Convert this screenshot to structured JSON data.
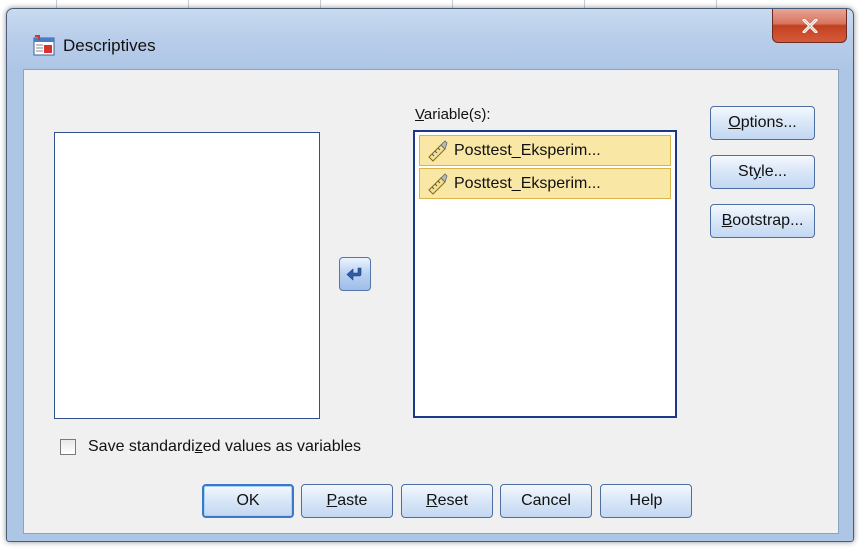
{
  "window": {
    "title": "Descriptives"
  },
  "variables_label": "Variable(s):",
  "variables_label_mnemonic": "V",
  "variables_label_rest": "ariable(s):",
  "selected_variables": [
    {
      "name": "Posttest_Eksperim...",
      "icon": "scale-ruler-icon"
    },
    {
      "name": "Posttest_Eksperim...",
      "icon": "scale-ruler-icon"
    }
  ],
  "side_buttons": {
    "options": {
      "pre": "",
      "mnemonic": "O",
      "post": "ptions..."
    },
    "style": {
      "pre": "St",
      "mnemonic": "y",
      "post": "le..."
    },
    "bootstrap": {
      "pre": "",
      "mnemonic": "B",
      "post": "ootstrap..."
    }
  },
  "checkbox": {
    "label_pre": "Save standardi",
    "label_mnemonic": "z",
    "label_post": "ed values as variables",
    "checked": false
  },
  "bottom_buttons": {
    "ok": {
      "pre": "OK",
      "mnemonic": "",
      "post": ""
    },
    "paste": {
      "pre": "",
      "mnemonic": "P",
      "post": "aste"
    },
    "reset": {
      "pre": "",
      "mnemonic": "R",
      "post": "eset"
    },
    "cancel": {
      "pre": "Cancel",
      "mnemonic": "",
      "post": ""
    },
    "help": {
      "pre": "Help",
      "mnemonic": "",
      "post": ""
    }
  },
  "colors": {
    "selection_fill": "#f9e7a6",
    "selection_border": "#d9b44a",
    "close_button": "#c2401f",
    "default_button_border": "#3b78c7"
  }
}
